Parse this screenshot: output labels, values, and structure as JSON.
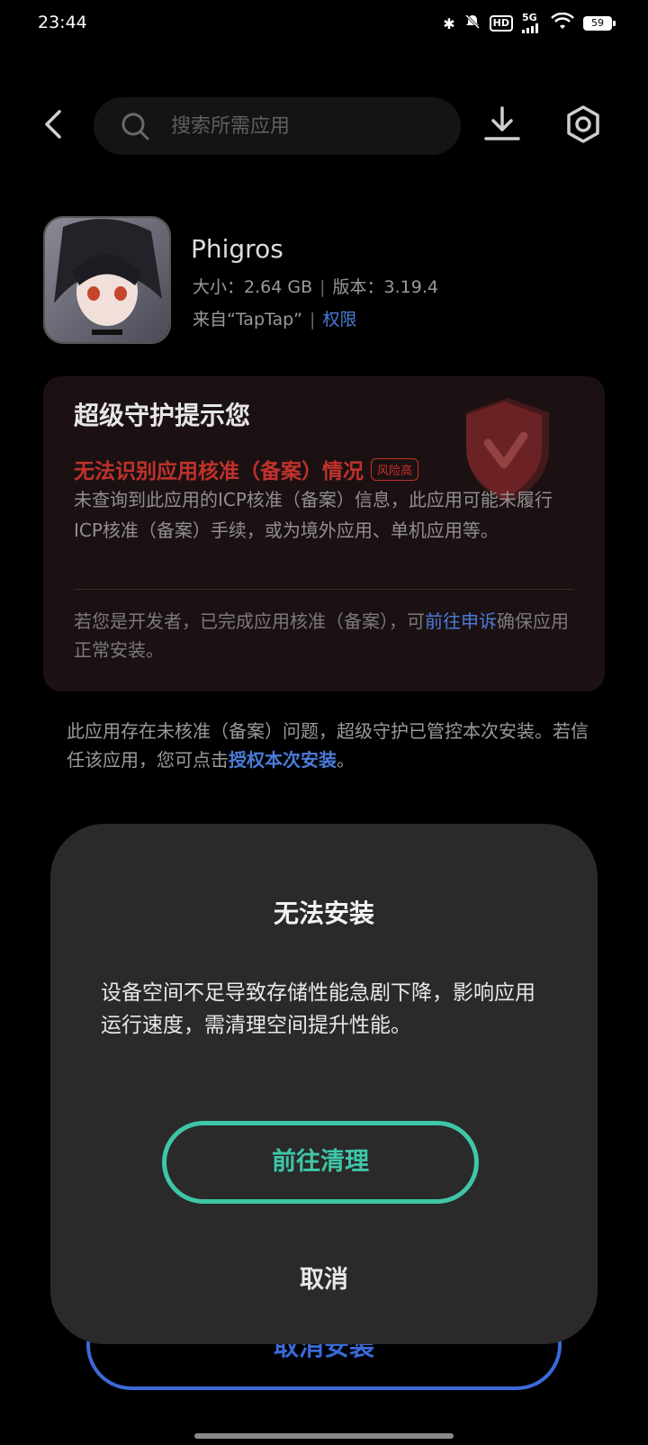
{
  "status_bar": {
    "time": "23:44",
    "network": "5G",
    "hd": "HD",
    "battery": "59"
  },
  "topbar": {
    "search_placeholder": "搜索所需应用"
  },
  "app": {
    "name": "Phigros",
    "size_label": "大小：2.64 GB",
    "version_label": "版本：3.19.4",
    "source_label": "来自“TapTap”",
    "permission_link": "权限"
  },
  "guard_card": {
    "title": "超级守护提示您",
    "risk_title": "无法识别应用核准（备案）情况",
    "risk_badge": "风险高",
    "risk_desc": "未查询到此应用的ICP核准（备案）信息，此应用可能未履行ICP核准（备案）手续，或为境外应用、单机应用等。",
    "dev_note_prefix": "若您是开发者，已完成应用核准（备案），可",
    "dev_note_link": "前往申诉",
    "dev_note_suffix": "确保应用正常安装。"
  },
  "bottom_note": {
    "text": "此应用存在未核准（备案）问题，超级守护已管控本次安装。若信任该应用，您可点击",
    "link": "授权本次安装",
    "end": "。"
  },
  "cancel_install_label": "取消安装",
  "dialog": {
    "title": "无法安装",
    "message": "设备空间不足导致存储性能急剧下降，影响应用运行速度，需清理空间提升性能。",
    "primary_button": "前往清理",
    "cancel_button": "取消"
  },
  "colors": {
    "accent_green": "#3ec7a7",
    "link_blue": "#4a7bd8",
    "risk_red": "#c0322c",
    "dialog_bg": "#2a2a2a"
  }
}
